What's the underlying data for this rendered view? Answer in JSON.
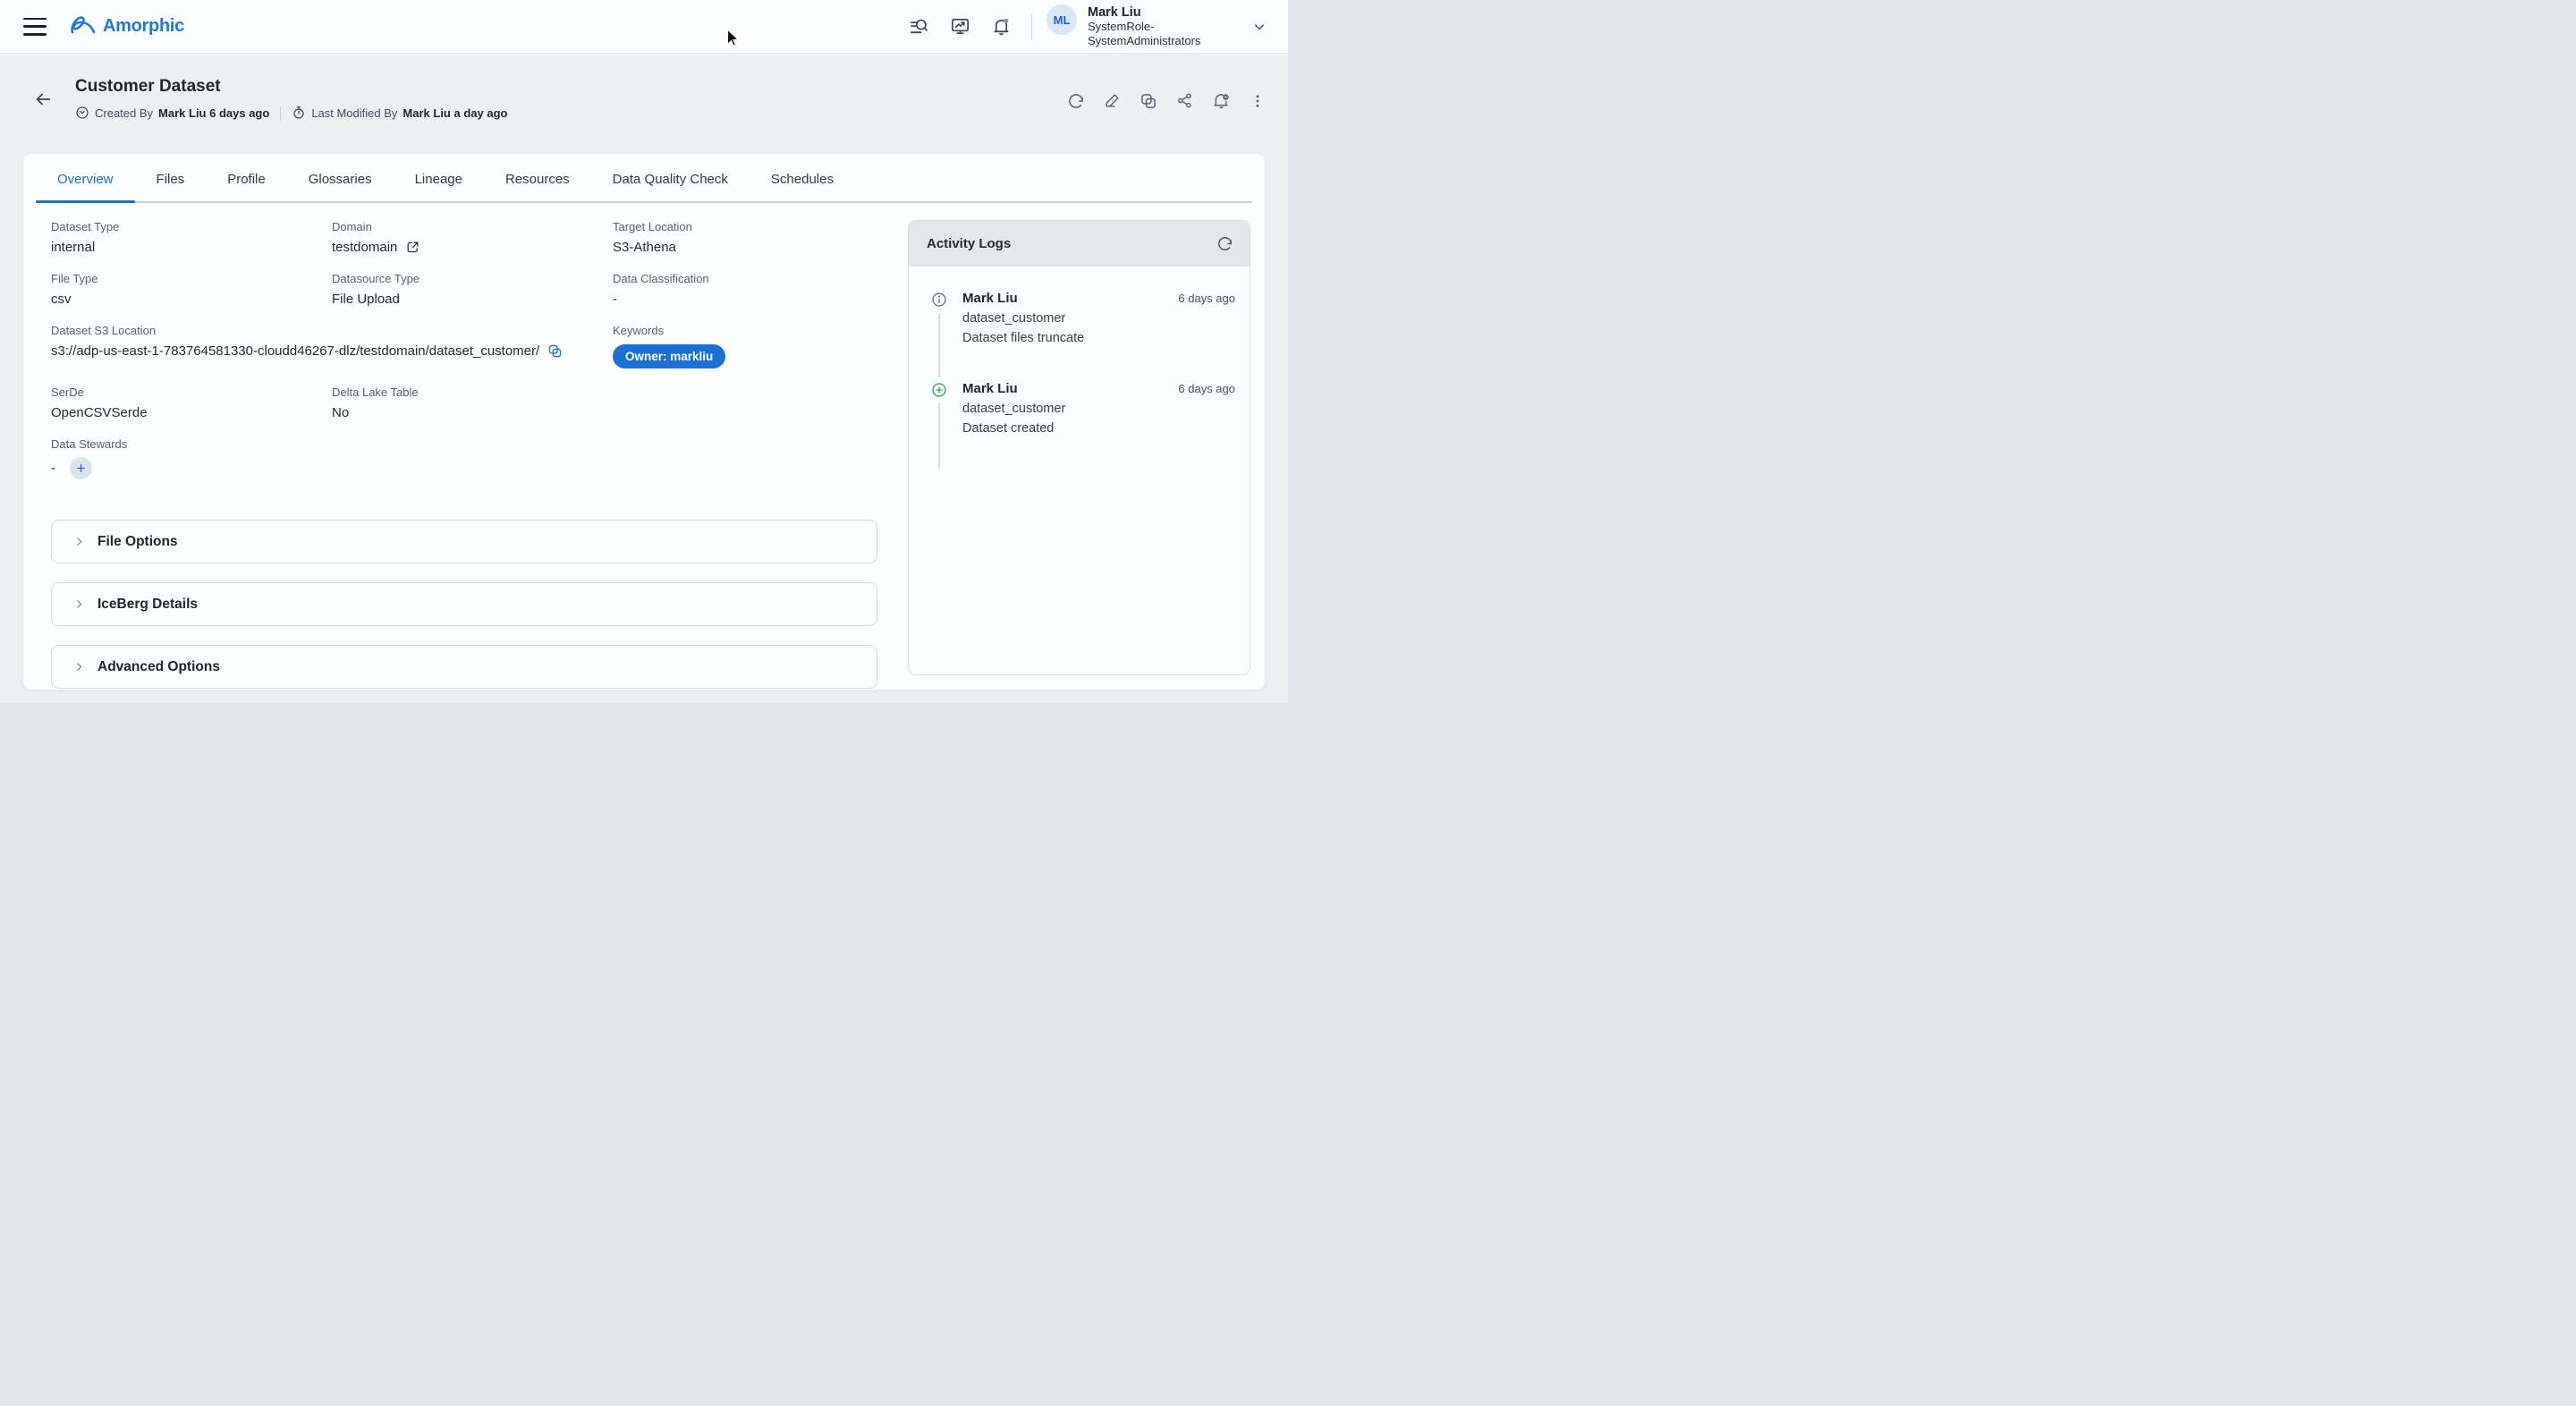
{
  "topbar": {
    "logo_text": "Amorphic",
    "user": {
      "initials": "ML",
      "name": "Mark Liu",
      "role_line1": "SystemRole-",
      "role_line2": "SystemAdministrators"
    }
  },
  "page_header": {
    "title": "Customer Dataset",
    "created": {
      "label": "Created By",
      "value": "Mark Liu 6 days ago"
    },
    "modified": {
      "label": "Last Modified By",
      "value": "Mark Liu a day ago"
    }
  },
  "tabs": [
    {
      "label": "Overview",
      "active": true
    },
    {
      "label": "Files",
      "active": false
    },
    {
      "label": "Profile",
      "active": false
    },
    {
      "label": "Glossaries",
      "active": false
    },
    {
      "label": "Lineage",
      "active": false
    },
    {
      "label": "Resources",
      "active": false
    },
    {
      "label": "Data Quality Check",
      "active": false
    },
    {
      "label": "Schedules",
      "active": false
    }
  ],
  "fields": {
    "dataset_type": {
      "label": "Dataset Type",
      "value": "internal"
    },
    "domain": {
      "label": "Domain",
      "value": "testdomain"
    },
    "target_location": {
      "label": "Target Location",
      "value": "S3-Athena"
    },
    "file_type": {
      "label": "File Type",
      "value": "csv"
    },
    "datasource_type": {
      "label": "Datasource Type",
      "value": "File Upload"
    },
    "data_classification": {
      "label": "Data Classification",
      "value": "-"
    },
    "s3_location": {
      "label": "Dataset S3 Location",
      "value": "s3://adp-us-east-1-783764581330-cloudd46267-dlz/testdomain/dataset_customer/"
    },
    "keywords": {
      "label": "Keywords",
      "pill": "Owner: markliu"
    },
    "serde": {
      "label": "SerDe",
      "value": "OpenCSVSerde"
    },
    "delta_lake": {
      "label": "Delta Lake Table",
      "value": "No"
    },
    "data_stewards": {
      "label": "Data Stewards",
      "value": "-"
    }
  },
  "sections": [
    {
      "label": "File Options"
    },
    {
      "label": "IceBerg Details"
    },
    {
      "label": "Advanced Options"
    }
  ],
  "activity": {
    "title": "Activity Logs",
    "entries": [
      {
        "user": "Mark Liu",
        "time": "6 days ago",
        "object": "dataset_customer",
        "action": "Dataset files truncate",
        "icon": "info"
      },
      {
        "user": "Mark Liu",
        "time": "6 days ago",
        "object": "dataset_customer",
        "action": "Dataset created",
        "icon": "plus-circle"
      }
    ]
  },
  "colors": {
    "accent_blue": "#1d6fca",
    "pill_blue": "#1a70d6",
    "logo_blue": "#2277dd",
    "copy_icon_blue": "#2b6bd4",
    "created_icon_green": "#3f9e52",
    "page_background": "#edeff3",
    "activity_header_gray": "#e4e6e9"
  }
}
